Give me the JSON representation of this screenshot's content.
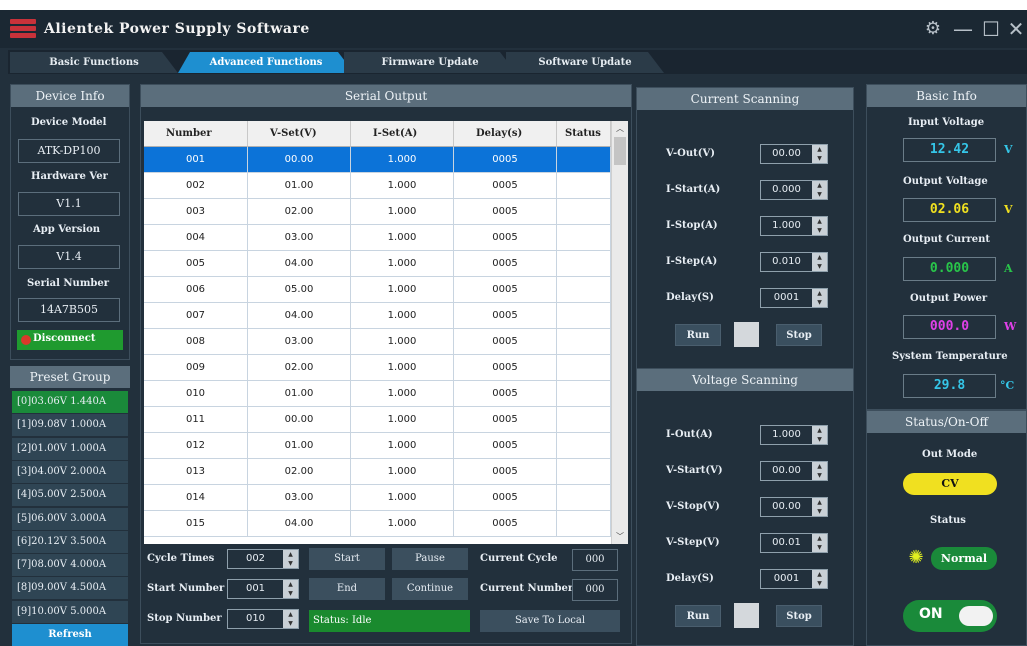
{
  "app": {
    "title": "Alientek Power Supply Software"
  },
  "tabs": [
    "Basic Functions",
    "Advanced Functions",
    "Firmware Update",
    "Software Update"
  ],
  "device_info": {
    "header": "Device Info",
    "model_label": "Device Model",
    "model": "ATK-DP100",
    "hw_label": "Hardware Ver",
    "hw": "V1.1",
    "app_label": "App Version",
    "app": "V1.4",
    "serial_label": "Serial Number",
    "serial": "14A7B505",
    "disconnect": "Disconnect"
  },
  "preset_group": {
    "header": "Preset Group",
    "items": [
      "[0]03.06V 1.440A",
      "[1]09.08V 1.000A",
      "[2]01.00V 1.000A",
      "[3]04.00V 2.000A",
      "[4]05.00V 2.500A",
      "[5]06.00V 3.000A",
      "[6]20.12V 3.500A",
      "[7]08.00V 4.000A",
      "[8]09.00V 4.500A",
      "[9]10.00V 5.000A"
    ],
    "refresh": "Refresh"
  },
  "serial_output": {
    "header": "Serial Output",
    "columns": [
      "Number",
      "V-Set(V)",
      "I-Set(A)",
      "Delay(s)",
      "Status"
    ],
    "rows": [
      [
        "001",
        "00.00",
        "1.000",
        "0005",
        ""
      ],
      [
        "002",
        "01.00",
        "1.000",
        "0005",
        ""
      ],
      [
        "003",
        "02.00",
        "1.000",
        "0005",
        ""
      ],
      [
        "004",
        "03.00",
        "1.000",
        "0005",
        ""
      ],
      [
        "005",
        "04.00",
        "1.000",
        "0005",
        ""
      ],
      [
        "006",
        "05.00",
        "1.000",
        "0005",
        ""
      ],
      [
        "007",
        "04.00",
        "1.000",
        "0005",
        ""
      ],
      [
        "008",
        "03.00",
        "1.000",
        "0005",
        ""
      ],
      [
        "009",
        "02.00",
        "1.000",
        "0005",
        ""
      ],
      [
        "010",
        "01.00",
        "1.000",
        "0005",
        ""
      ],
      [
        "011",
        "00.00",
        "1.000",
        "0005",
        ""
      ],
      [
        "012",
        "01.00",
        "1.000",
        "0005",
        ""
      ],
      [
        "013",
        "02.00",
        "1.000",
        "0005",
        ""
      ],
      [
        "014",
        "03.00",
        "1.000",
        "0005",
        ""
      ],
      [
        "015",
        "04.00",
        "1.000",
        "0005",
        ""
      ]
    ],
    "cycle_times_label": "Cycle Times",
    "cycle_times": "002",
    "start_number_label": "Start Number",
    "start_number": "001",
    "stop_number_label": "Stop Number",
    "stop_number": "010",
    "start": "Start",
    "pause": "Pause",
    "end": "End",
    "continue": "Continue",
    "status": "Status: Idle",
    "current_cycle_label": "Current Cycle",
    "current_cycle": "000",
    "current_number_label": "Current Number",
    "current_number": "000",
    "save": "Save To Local"
  },
  "current_scanning": {
    "header": "Current Scanning",
    "fields": [
      {
        "label": "V-Out(V)",
        "value": "00.00"
      },
      {
        "label": "I-Start(A)",
        "value": "0.000"
      },
      {
        "label": "I-Stop(A)",
        "value": "1.000"
      },
      {
        "label": "I-Step(A)",
        "value": "0.010"
      },
      {
        "label": "Delay(S)",
        "value": "0001"
      }
    ],
    "run": "Run",
    "stop": "Stop"
  },
  "voltage_scanning": {
    "header": "Voltage Scanning",
    "fields": [
      {
        "label": "I-Out(A)",
        "value": "1.000"
      },
      {
        "label": "V-Start(V)",
        "value": "00.00"
      },
      {
        "label": "V-Stop(V)",
        "value": "00.00"
      },
      {
        "label": "V-Step(V)",
        "value": "00.01"
      },
      {
        "label": "Delay(S)",
        "value": "0001"
      }
    ],
    "run": "Run",
    "stop": "Stop"
  },
  "basic_info": {
    "header": "Basic Info",
    "input_voltage_label": "Input Voltage",
    "input_voltage": "12.42",
    "input_voltage_unit": "V",
    "output_voltage_label": "Output Voltage",
    "output_voltage": "02.06",
    "output_voltage_unit": "V",
    "output_current_label": "Output Current",
    "output_current": "0.000",
    "output_current_unit": "A",
    "output_power_label": "Output Power",
    "output_power": "000.0",
    "output_power_unit": "W",
    "temp_label": "System Temperature",
    "temp": "29.8",
    "temp_unit": "°C"
  },
  "status_onoff": {
    "header": "Status/On-Off",
    "out_mode_label": "Out Mode",
    "out_mode": "CV",
    "status_label": "Status",
    "status": "Normal",
    "toggle": "ON"
  },
  "colors": {
    "cyan": "#35c6e8",
    "yellow": "#f0e020",
    "green": "#29c64a",
    "magenta": "#e040e8",
    "accent": "#1e8fd0"
  }
}
